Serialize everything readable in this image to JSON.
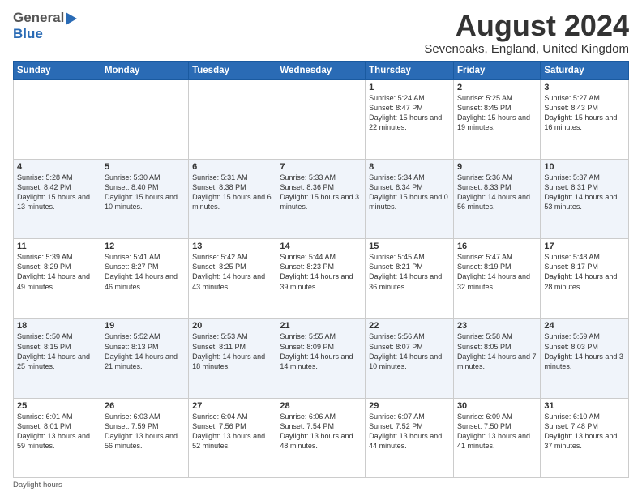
{
  "header": {
    "logo_general": "General",
    "logo_blue": "Blue",
    "title": "August 2024",
    "location": "Sevenoaks, England, United Kingdom"
  },
  "days_of_week": [
    "Sunday",
    "Monday",
    "Tuesday",
    "Wednesday",
    "Thursday",
    "Friday",
    "Saturday"
  ],
  "weeks": [
    [
      {
        "day": "",
        "info": ""
      },
      {
        "day": "",
        "info": ""
      },
      {
        "day": "",
        "info": ""
      },
      {
        "day": "",
        "info": ""
      },
      {
        "day": "1",
        "info": "Sunrise: 5:24 AM\nSunset: 8:47 PM\nDaylight: 15 hours\nand 22 minutes."
      },
      {
        "day": "2",
        "info": "Sunrise: 5:25 AM\nSunset: 8:45 PM\nDaylight: 15 hours\nand 19 minutes."
      },
      {
        "day": "3",
        "info": "Sunrise: 5:27 AM\nSunset: 8:43 PM\nDaylight: 15 hours\nand 16 minutes."
      }
    ],
    [
      {
        "day": "4",
        "info": "Sunrise: 5:28 AM\nSunset: 8:42 PM\nDaylight: 15 hours\nand 13 minutes."
      },
      {
        "day": "5",
        "info": "Sunrise: 5:30 AM\nSunset: 8:40 PM\nDaylight: 15 hours\nand 10 minutes."
      },
      {
        "day": "6",
        "info": "Sunrise: 5:31 AM\nSunset: 8:38 PM\nDaylight: 15 hours\nand 6 minutes."
      },
      {
        "day": "7",
        "info": "Sunrise: 5:33 AM\nSunset: 8:36 PM\nDaylight: 15 hours\nand 3 minutes."
      },
      {
        "day": "8",
        "info": "Sunrise: 5:34 AM\nSunset: 8:34 PM\nDaylight: 15 hours\nand 0 minutes."
      },
      {
        "day": "9",
        "info": "Sunrise: 5:36 AM\nSunset: 8:33 PM\nDaylight: 14 hours\nand 56 minutes."
      },
      {
        "day": "10",
        "info": "Sunrise: 5:37 AM\nSunset: 8:31 PM\nDaylight: 14 hours\nand 53 minutes."
      }
    ],
    [
      {
        "day": "11",
        "info": "Sunrise: 5:39 AM\nSunset: 8:29 PM\nDaylight: 14 hours\nand 49 minutes."
      },
      {
        "day": "12",
        "info": "Sunrise: 5:41 AM\nSunset: 8:27 PM\nDaylight: 14 hours\nand 46 minutes."
      },
      {
        "day": "13",
        "info": "Sunrise: 5:42 AM\nSunset: 8:25 PM\nDaylight: 14 hours\nand 43 minutes."
      },
      {
        "day": "14",
        "info": "Sunrise: 5:44 AM\nSunset: 8:23 PM\nDaylight: 14 hours\nand 39 minutes."
      },
      {
        "day": "15",
        "info": "Sunrise: 5:45 AM\nSunset: 8:21 PM\nDaylight: 14 hours\nand 36 minutes."
      },
      {
        "day": "16",
        "info": "Sunrise: 5:47 AM\nSunset: 8:19 PM\nDaylight: 14 hours\nand 32 minutes."
      },
      {
        "day": "17",
        "info": "Sunrise: 5:48 AM\nSunset: 8:17 PM\nDaylight: 14 hours\nand 28 minutes."
      }
    ],
    [
      {
        "day": "18",
        "info": "Sunrise: 5:50 AM\nSunset: 8:15 PM\nDaylight: 14 hours\nand 25 minutes."
      },
      {
        "day": "19",
        "info": "Sunrise: 5:52 AM\nSunset: 8:13 PM\nDaylight: 14 hours\nand 21 minutes."
      },
      {
        "day": "20",
        "info": "Sunrise: 5:53 AM\nSunset: 8:11 PM\nDaylight: 14 hours\nand 18 minutes."
      },
      {
        "day": "21",
        "info": "Sunrise: 5:55 AM\nSunset: 8:09 PM\nDaylight: 14 hours\nand 14 minutes."
      },
      {
        "day": "22",
        "info": "Sunrise: 5:56 AM\nSunset: 8:07 PM\nDaylight: 14 hours\nand 10 minutes."
      },
      {
        "day": "23",
        "info": "Sunrise: 5:58 AM\nSunset: 8:05 PM\nDaylight: 14 hours\nand 7 minutes."
      },
      {
        "day": "24",
        "info": "Sunrise: 5:59 AM\nSunset: 8:03 PM\nDaylight: 14 hours\nand 3 minutes."
      }
    ],
    [
      {
        "day": "25",
        "info": "Sunrise: 6:01 AM\nSunset: 8:01 PM\nDaylight: 13 hours\nand 59 minutes."
      },
      {
        "day": "26",
        "info": "Sunrise: 6:03 AM\nSunset: 7:59 PM\nDaylight: 13 hours\nand 56 minutes."
      },
      {
        "day": "27",
        "info": "Sunrise: 6:04 AM\nSunset: 7:56 PM\nDaylight: 13 hours\nand 52 minutes."
      },
      {
        "day": "28",
        "info": "Sunrise: 6:06 AM\nSunset: 7:54 PM\nDaylight: 13 hours\nand 48 minutes."
      },
      {
        "day": "29",
        "info": "Sunrise: 6:07 AM\nSunset: 7:52 PM\nDaylight: 13 hours\nand 44 minutes."
      },
      {
        "day": "30",
        "info": "Sunrise: 6:09 AM\nSunset: 7:50 PM\nDaylight: 13 hours\nand 41 minutes."
      },
      {
        "day": "31",
        "info": "Sunrise: 6:10 AM\nSunset: 7:48 PM\nDaylight: 13 hours\nand 37 minutes."
      }
    ]
  ],
  "footer": {
    "note": "Daylight hours"
  }
}
